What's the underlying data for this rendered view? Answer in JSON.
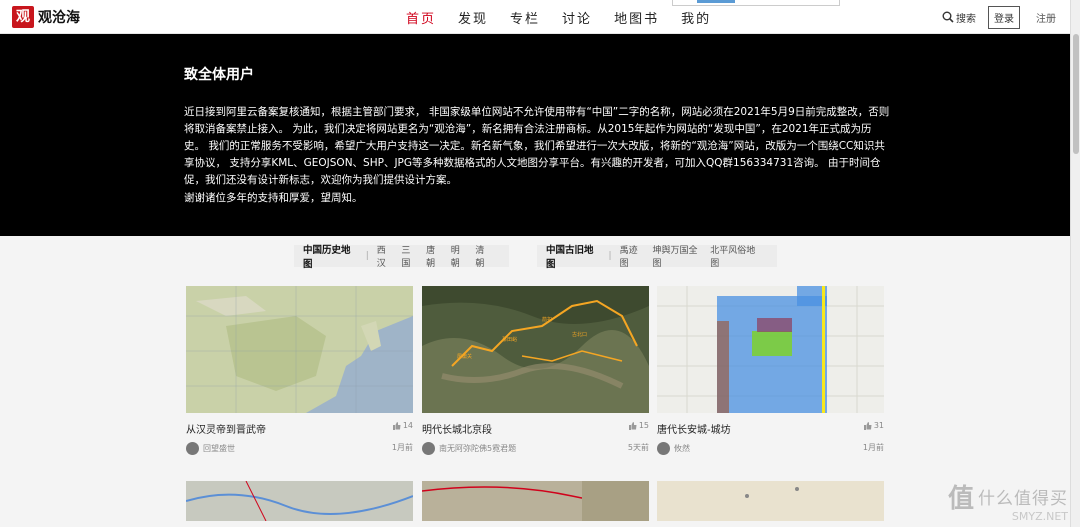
{
  "logo": {
    "mark": "观",
    "text": "观沧海"
  },
  "nav": [
    {
      "label": "首页"
    },
    {
      "label": "发现"
    },
    {
      "label": "专栏"
    },
    {
      "label": "讨论"
    },
    {
      "label": "地图书"
    },
    {
      "label": "我的"
    }
  ],
  "top": {
    "search": "搜索",
    "login": "登录",
    "register": "注册"
  },
  "banner": {
    "title": "致全体用户",
    "p1": "近日接到阿里云备案复核通知，根据主管部门要求， 非国家级单位网站不允许使用带有“中国”二字的名称，网站必须在2021年5月9日前完成整改，否则将取消备案禁止接入。 为此，我们决定将网站更名为“观沧海”，新名拥有合法注册商标。从2015年起作为网站的“发现中国”，在2021年正式成为历史。 我们的正常服务不受影响，希望广大用户支持这一决定。新名新气象，我们希望进行一次大改版，将新的“观沧海”网站，改版为一个围绕CC知识共享协议， 支持分享KML、GEOJSON、SHP、JPG等多种数据格式的人文地图分享平台。有兴趣的开发者，可加入QQ群156334731咨询。 由于时间仓促，我们还没有设计新标志，欢迎你为我们提供设计方案。",
    "p2": "谢谢诸位多年的支持和厚爱，望周知。"
  },
  "filters": [
    {
      "title": "中国历史地图",
      "items": [
        "西汉",
        "三国",
        "唐朝",
        "明朝",
        "清朝"
      ]
    },
    {
      "title": "中国古旧地图",
      "items": [
        "禹迹图",
        "坤舆万国全图",
        "北平风俗地图"
      ]
    }
  ],
  "cards": [
    {
      "title": "从汉灵帝到晋武帝",
      "likes": "14",
      "author": "回望盛世",
      "time": "1月前"
    },
    {
      "title": "明代长城北京段",
      "likes": "15",
      "author": "南无阿弥陀佛5霓君题",
      "time": "5天前"
    },
    {
      "title": "唐代长安城-城坊",
      "likes": "31",
      "author": "攸然",
      "time": "1月前"
    }
  ],
  "watermark": {
    "text": "什么值得买",
    "sub": "SMYZ.NET"
  }
}
